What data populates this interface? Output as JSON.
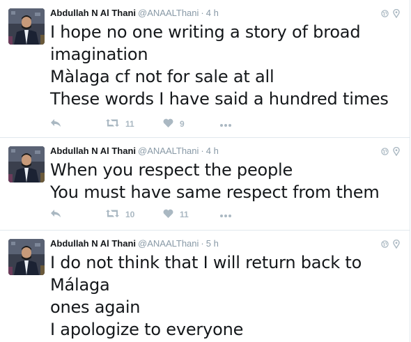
{
  "colors": {
    "text": "#14171a",
    "secondary": "#8899a6",
    "action_icon": "#aab8c2",
    "divider": "#e1e8ed"
  },
  "tweets": [
    {
      "author": {
        "name": "Abdullah N Al Thani",
        "handle": "@ANAALThani"
      },
      "separator": "·",
      "time": "4 h",
      "text_lines": [
        "I hope no one writing a story of broad",
        "imagination",
        "Màlaga cf not for sale at all",
        "These words I have said a hundred times"
      ],
      "retweets": "11",
      "likes": "9"
    },
    {
      "author": {
        "name": "Abdullah N Al Thani",
        "handle": "@ANAALThani"
      },
      "separator": "·",
      "time": "4 h",
      "text_lines": [
        "When you respect the people",
        "You must have same respect from them"
      ],
      "retweets": "10",
      "likes": "11"
    },
    {
      "author": {
        "name": "Abdullah N Al Thani",
        "handle": "@ANAALThani"
      },
      "separator": "·",
      "time": "5 h",
      "text_lines": [
        "I do not think that I will return back to",
        "Málaga",
        "ones again",
        "I apologize to everyone"
      ]
    }
  ],
  "icons": {
    "globe": "globe-icon",
    "location": "location-pin-icon",
    "reply": "reply-icon",
    "retweet": "retweet-icon",
    "like": "heart-icon",
    "more": "more-dots-icon"
  }
}
